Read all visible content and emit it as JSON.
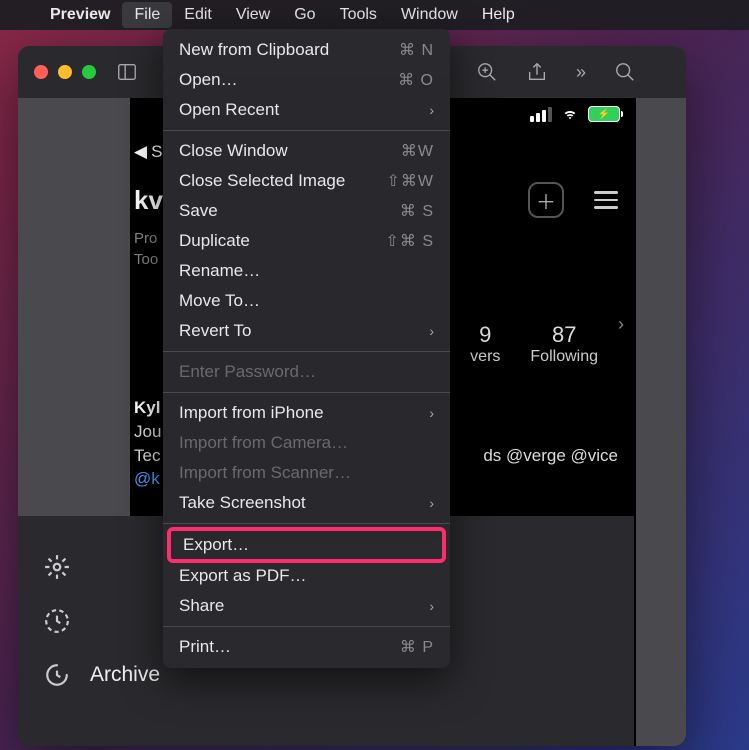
{
  "menubar": {
    "app": "Preview",
    "items": [
      "File",
      "Edit",
      "View",
      "Go",
      "Tools",
      "Window",
      "Help"
    ],
    "active_index": 0
  },
  "dropdown": {
    "groups": [
      [
        {
          "label": "New from Clipboard",
          "shortcut": "⌘ N",
          "enabled": true
        },
        {
          "label": "Open…",
          "shortcut": "⌘ O",
          "enabled": true
        },
        {
          "label": "Open Recent",
          "submenu": true,
          "enabled": true
        }
      ],
      [
        {
          "label": "Close Window",
          "shortcut": "⌘W",
          "enabled": true
        },
        {
          "label": "Close Selected Image",
          "shortcut": "⇧⌘W",
          "enabled": true
        },
        {
          "label": "Save",
          "shortcut": "⌘ S",
          "enabled": true
        },
        {
          "label": "Duplicate",
          "shortcut": "⇧⌘ S",
          "enabled": true
        },
        {
          "label": "Rename…",
          "enabled": true
        },
        {
          "label": "Move To…",
          "enabled": true
        },
        {
          "label": "Revert To",
          "submenu": true,
          "enabled": true
        }
      ],
      [
        {
          "label": "Enter Password…",
          "enabled": false
        }
      ],
      [
        {
          "label": "Import from iPhone",
          "submenu": true,
          "enabled": true
        },
        {
          "label": "Import from Camera…",
          "enabled": false
        },
        {
          "label": "Import from Scanner…",
          "enabled": false
        },
        {
          "label": "Take Screenshot",
          "submenu": true,
          "enabled": true
        }
      ],
      [
        {
          "label": "Export…",
          "enabled": true,
          "highlighted": true
        },
        {
          "label": "Export as PDF…",
          "enabled": true
        },
        {
          "label": "Share",
          "submenu": true,
          "enabled": true
        }
      ],
      [
        {
          "label": "Print…",
          "shortcut": "⌘ P",
          "enabled": true
        }
      ]
    ]
  },
  "content": {
    "back_label": "Se",
    "username_prefix": "kv",
    "subtitle_line1": "Pro",
    "subtitle_line2": "Too",
    "followers_count": "9",
    "followers_label": "vers",
    "following_count": "87",
    "following_label": "Following",
    "bio_name": "Kyl",
    "bio_line2": "Jou",
    "bio_line3": "Tec",
    "bio_handle": "@k",
    "bio_tail": "ds @verge @vice"
  },
  "bottom": {
    "archive": "Archive"
  }
}
